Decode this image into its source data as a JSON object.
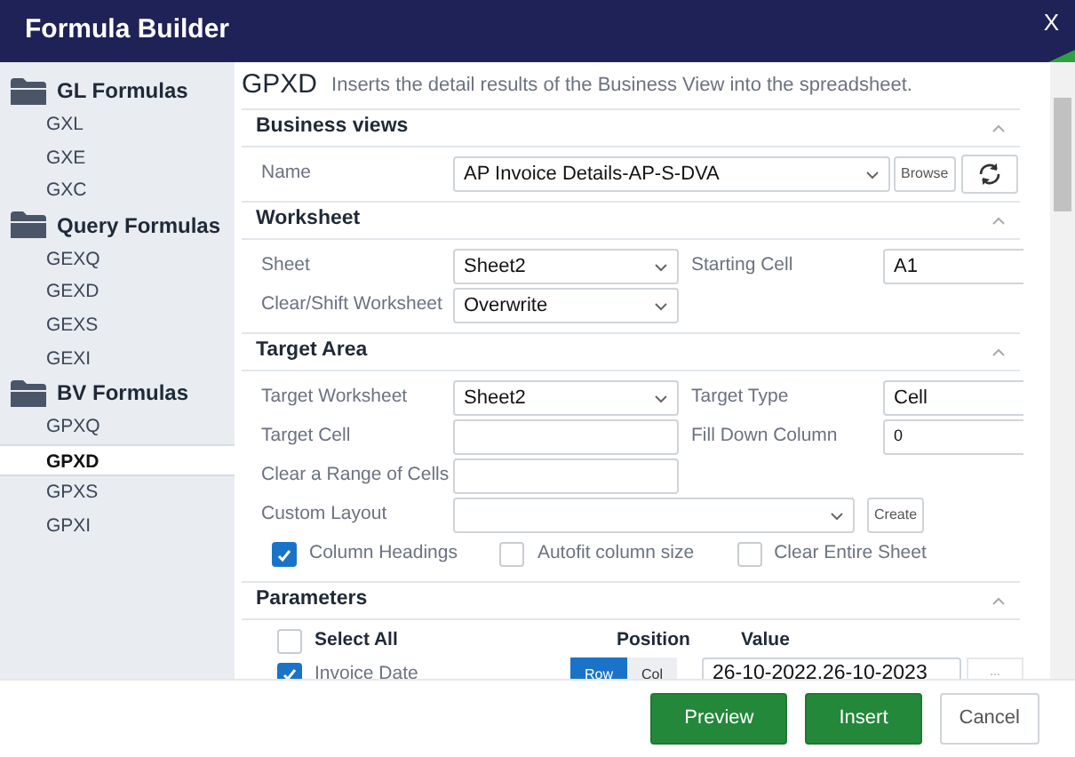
{
  "window": {
    "title": "Formula Builder",
    "close": "X"
  },
  "sidebar": [
    {
      "label": "GL Formulas",
      "items": [
        {
          "label": "GXL",
          "selected": false
        },
        {
          "label": "GXE",
          "selected": false
        },
        {
          "label": "GXC",
          "selected": false
        }
      ]
    },
    {
      "label": "Query Formulas",
      "items": [
        {
          "label": "GEXQ",
          "selected": false
        },
        {
          "label": "GEXD",
          "selected": false
        },
        {
          "label": "GEXS",
          "selected": false
        },
        {
          "label": "GEXI",
          "selected": false
        }
      ]
    },
    {
      "label": "BV Formulas",
      "items": [
        {
          "label": "GPXQ",
          "selected": false
        },
        {
          "label": "GPXD",
          "selected": true
        },
        {
          "label": "GPXS",
          "selected": false
        },
        {
          "label": "GPXI",
          "selected": false
        }
      ]
    }
  ],
  "header": {
    "code": "GPXD",
    "description": "Inserts the detail results of the Business View into the spreadsheet."
  },
  "sections": [
    {
      "title": "Business views",
      "rows": [
        [
          {
            "kind": "select_wide",
            "label": "Name",
            "value": "AP Invoice Details-AP-S-DVA",
            "button": "Browse",
            "refresh_button": true
          }
        ]
      ]
    },
    {
      "title": "Worksheet",
      "rows": [
        [
          {
            "kind": "select",
            "label": "Sheet",
            "value": "Sheet2"
          },
          {
            "kind": "input",
            "label": "Starting Cell",
            "value": "A1"
          }
        ],
        [
          {
            "kind": "select",
            "label": "Clear/Shift Worksheet",
            "value": "Overwrite"
          }
        ]
      ]
    },
    {
      "title": "Target Area",
      "rows": [
        [
          {
            "kind": "select",
            "label": "Target Worksheet",
            "value": "Sheet2"
          },
          {
            "kind": "input",
            "label": "Target Type",
            "value": "Cell"
          }
        ],
        [
          {
            "kind": "input",
            "label": "Target Cell"
          },
          {
            "kind": "input_small",
            "label": "Fill Down Column",
            "value": "0"
          }
        ],
        [
          {
            "kind": "input",
            "label": "Clear a Range of Cells"
          }
        ],
        [
          {
            "kind": "select_medium",
            "label": "Custom Layout",
            "button": "Create"
          }
        ]
      ],
      "checkboxes": [
        {
          "label": "Column Headings",
          "checked": true
        },
        {
          "label": "Autofit column size",
          "checked": false
        },
        {
          "label": "Clear Entire Sheet",
          "checked": false
        }
      ]
    }
  ],
  "parameters": {
    "title": "Parameters",
    "select_all": {
      "label": "Select All",
      "checked": false
    },
    "position_header": "Position",
    "value_header": "Value",
    "rows": [
      {
        "label": "Invoice Date",
        "checked": true,
        "positions": [
          {
            "label": "Row",
            "selected": true
          },
          {
            "label": "Col",
            "selected": false
          }
        ],
        "value": "26-10-2022.26-10-2023",
        "more": "..."
      }
    ]
  },
  "footer": {
    "buttons": [
      {
        "label": "Preview",
        "kind": "primary"
      },
      {
        "label": "Insert",
        "kind": "primary"
      },
      {
        "label": "Cancel",
        "kind": "secondary"
      }
    ]
  }
}
